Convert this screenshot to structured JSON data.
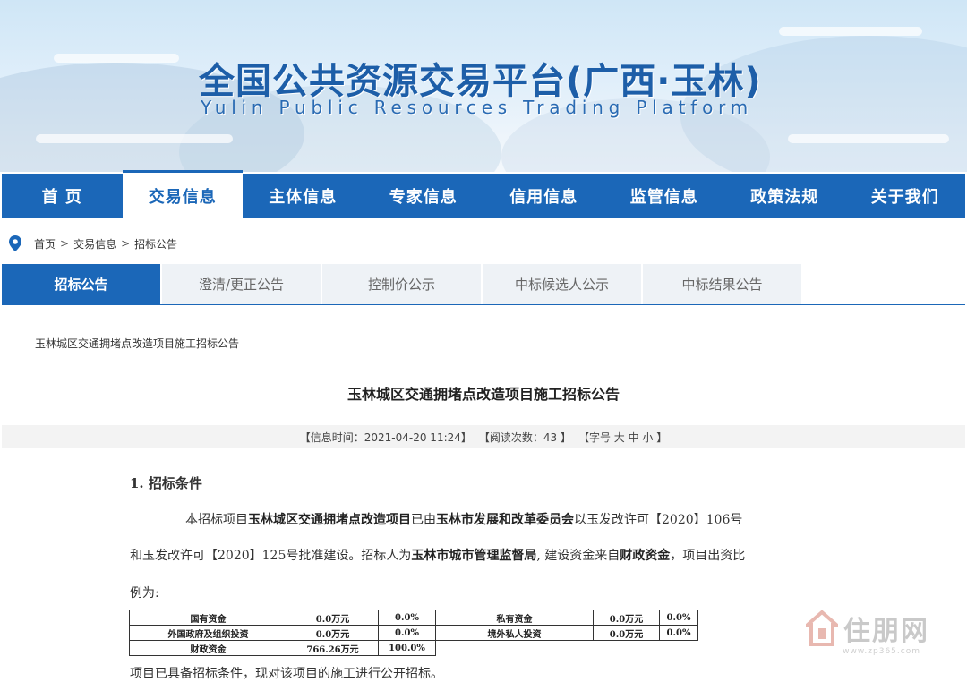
{
  "header": {
    "title": "全国公共资源交易平台(广西·玉林)",
    "subtitle": "Yulin Public Resources Trading Platform"
  },
  "nav": {
    "items": [
      {
        "label": "首 页"
      },
      {
        "label": "交易信息"
      },
      {
        "label": "主体信息"
      },
      {
        "label": "专家信息"
      },
      {
        "label": "信用信息"
      },
      {
        "label": "监管信息"
      },
      {
        "label": "政策法规"
      },
      {
        "label": "关于我们"
      }
    ],
    "active_index": 1
  },
  "breadcrumb": {
    "items": [
      "首页",
      "交易信息",
      "招标公告"
    ],
    "separator": ">",
    "icon": "location-pin-icon"
  },
  "tabs": {
    "items": [
      {
        "label": "招标公告"
      },
      {
        "label": "澄清/更正公告"
      },
      {
        "label": "控制价公示"
      },
      {
        "label": "中标候选人公示"
      },
      {
        "label": "中标结果公告"
      }
    ],
    "active_index": 0
  },
  "article": {
    "list_label": "玉林城区交通拥堵点改造项目施工招标公告",
    "title": "玉林城区交通拥堵点改造项目施工招标公告",
    "meta": {
      "time": "【信息时间：2021-04-20 11:24】",
      "views": "【阅读次数：43 】",
      "font_size": "【字号 大 中 小 】"
    },
    "section1_heading": "1. 招标条件",
    "para1": {
      "t1": "本招标项目",
      "b1": "玉林城区交通拥堵点改造项目",
      "t2": "已由",
      "b2": "玉林市发展和改革委员会",
      "t3": "以玉发改许可【2020】106号"
    },
    "para2": {
      "t1": "和玉发改许可【2020】125号批准建设。招标人为",
      "b1": "玉林市城市管理监督局",
      "t2": ", 建设资金来自",
      "b2": "财政资金",
      "t3": "，项目出资比"
    },
    "para3": "例为:",
    "fund_table": {
      "rows": [
        [
          "国有资金",
          "0.0万元",
          "0.0%",
          "私有资金",
          "0.0万元",
          "0.0%"
        ],
        [
          "外国政府及组织投资",
          "0.0万元",
          "0.0%",
          "境外私人投资",
          "0.0万元",
          "0.0%"
        ],
        [
          "财政资金",
          "766.26万元",
          "100.0%",
          "",
          "",
          ""
        ]
      ]
    },
    "para4": "项目已具备招标条件，现对该项目的施工进行公开招标。"
  },
  "watermark": {
    "text": "住朋网",
    "url": "www.zp365.com"
  },
  "colors": {
    "primary": "#1b67b8",
    "tab_inactive_bg": "#eef2f6",
    "meta_bar_bg": "#f3f3f3"
  }
}
